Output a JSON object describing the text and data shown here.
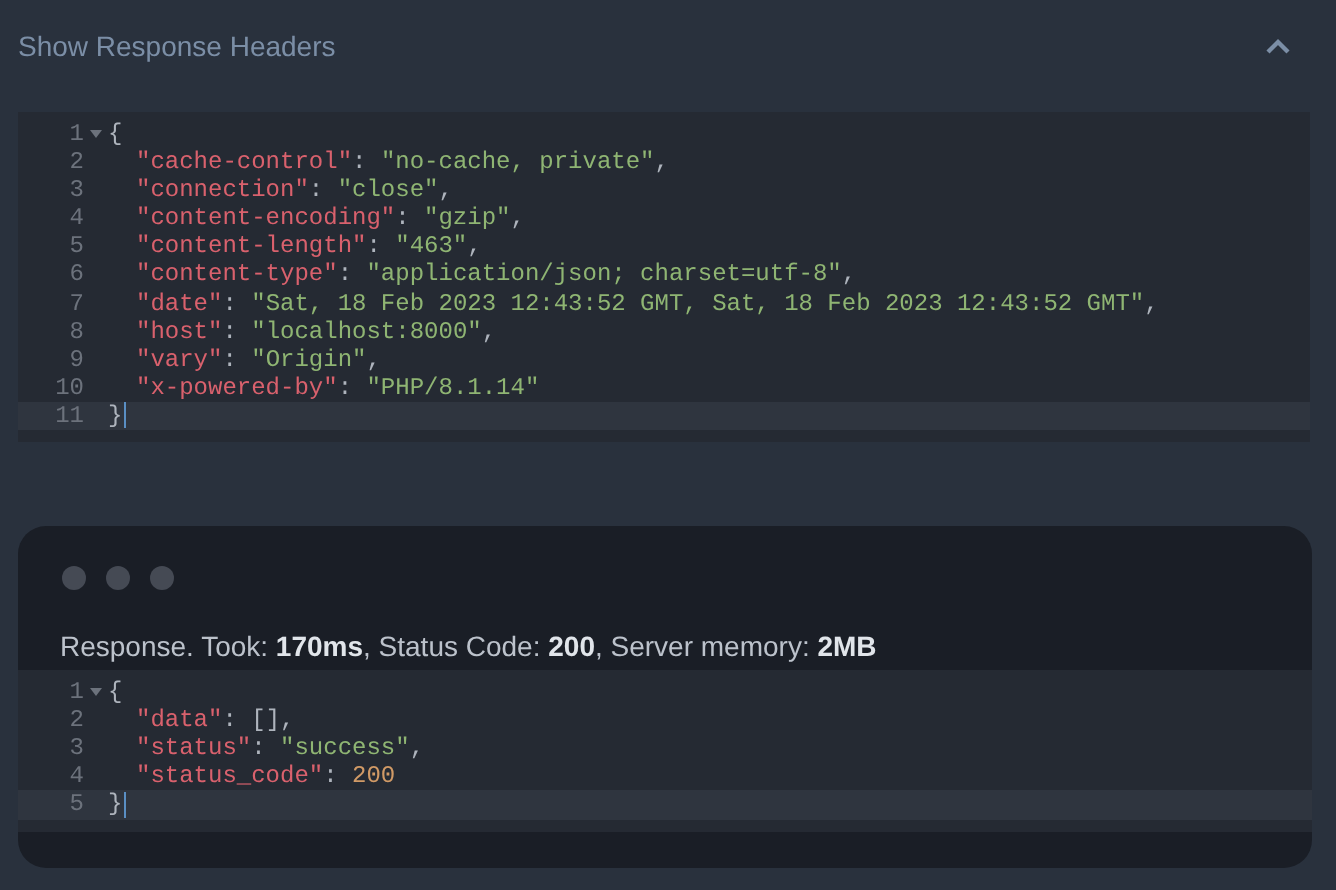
{
  "section": {
    "title": "Show Response Headers",
    "expanded": true
  },
  "headers_code": {
    "lines": [
      {
        "number": "1",
        "foldable": true,
        "selected": false,
        "tokens": [
          {
            "kind": "punct",
            "text": "{"
          }
        ],
        "children": [
          {
            "number": "2",
            "selected": false,
            "tokens": [
              {
                "kind": "key",
                "text": "\"cache-control\""
              },
              {
                "kind": "punct",
                "text": ":"
              },
              {
                "kind": "string",
                "text": "\"no-cache, private\""
              },
              {
                "kind": "punct",
                "text": ","
              }
            ]
          },
          {
            "number": "3",
            "selected": false,
            "tokens": [
              {
                "kind": "key",
                "text": "\"connection\""
              },
              {
                "kind": "punct",
                "text": ":"
              },
              {
                "kind": "string",
                "text": "\"close\""
              },
              {
                "kind": "punct",
                "text": ","
              }
            ]
          },
          {
            "number": "4",
            "selected": false,
            "tokens": [
              {
                "kind": "key",
                "text": "\"content-encoding\""
              },
              {
                "kind": "punct",
                "text": ":"
              },
              {
                "kind": "string",
                "text": "\"gzip\""
              },
              {
                "kind": "punct",
                "text": ","
              }
            ]
          },
          {
            "number": "5",
            "selected": false,
            "tokens": [
              {
                "kind": "key",
                "text": "\"content-length\""
              },
              {
                "kind": "punct",
                "text": ":"
              },
              {
                "kind": "string",
                "text": "\"463\""
              },
              {
                "kind": "punct",
                "text": ","
              }
            ]
          },
          {
            "number": "6",
            "selected": false,
            "tokens": [
              {
                "kind": "key",
                "text": "\"content-type\""
              },
              {
                "kind": "punct",
                "text": ":"
              },
              {
                "kind": "string",
                "text": "\"application/json; charset=utf-8\""
              },
              {
                "kind": "punct",
                "text": ","
              }
            ]
          },
          {
            "number": "7",
            "selected": false,
            "tokens": [
              {
                "kind": "key",
                "text": "\"date\""
              },
              {
                "kind": "punct",
                "text": ":"
              },
              {
                "kind": "string",
                "text": "\"Sat, 18 Feb 2023 12:43:52 GMT, Sat, 18 Feb 2023 12:43:52 GMT\""
              },
              {
                "kind": "punct",
                "text": ","
              }
            ]
          },
          {
            "number": "8",
            "selected": false,
            "tokens": [
              {
                "kind": "key",
                "text": "\"host\""
              },
              {
                "kind": "punct",
                "text": ":"
              },
              {
                "kind": "string",
                "text": "\"localhost:8000\""
              },
              {
                "kind": "punct",
                "text": ","
              }
            ]
          },
          {
            "number": "9",
            "selected": false,
            "tokens": [
              {
                "kind": "key",
                "text": "\"vary\""
              },
              {
                "kind": "punct",
                "text": ":"
              },
              {
                "kind": "string",
                "text": "\"Origin\""
              },
              {
                "kind": "punct",
                "text": ","
              }
            ]
          },
          {
            "number": "10",
            "selected": false,
            "tokens": [
              {
                "kind": "key",
                "text": "\"x-powered-by\""
              },
              {
                "kind": "punct",
                "text": ":"
              },
              {
                "kind": "string",
                "text": "\"PHP/8.1.14\""
              }
            ]
          }
        ]
      },
      {
        "number": "11",
        "selected": true,
        "tokens": [
          {
            "kind": "punct",
            "text": "}"
          }
        ]
      }
    ]
  },
  "response": {
    "status": "Response. Took: **170ms**, Status Code: **200**, Server memory: **2MB**",
    "code": {
      "lines": [
        {
          "number": "1",
          "foldable": true,
          "selected": false,
          "tokens": [
            {
              "kind": "punct",
              "text": "{"
            }
          ],
          "children": [
            {
              "number": "2",
              "selected": false,
              "tokens": [
                {
                  "kind": "key",
                  "text": "\"data\""
                },
                {
                  "kind": "punct",
                  "text": ":"
                },
                {
                  "kind": "punct",
                  "text": "[],"
                }
              ]
            },
            {
              "number": "3",
              "selected": false,
              "tokens": [
                {
                  "kind": "key",
                  "text": "\"status\""
                },
                {
                  "kind": "punct",
                  "text": ":"
                },
                {
                  "kind": "string",
                  "text": "\"success\""
                },
                {
                  "kind": "punct",
                  "text": ","
                }
              ]
            },
            {
              "number": "4",
              "selected": false,
              "tokens": [
                {
                  "kind": "key",
                  "text": "\"status_code\""
                },
                {
                  "kind": "punct",
                  "text": ":"
                },
                {
                  "kind": "number",
                  "text": "200"
                }
              ]
            }
          ]
        },
        {
          "number": "5",
          "selected": true,
          "tokens": [
            {
              "kind": "punct",
              "text": "}"
            }
          ]
        }
      ]
    }
  }
}
